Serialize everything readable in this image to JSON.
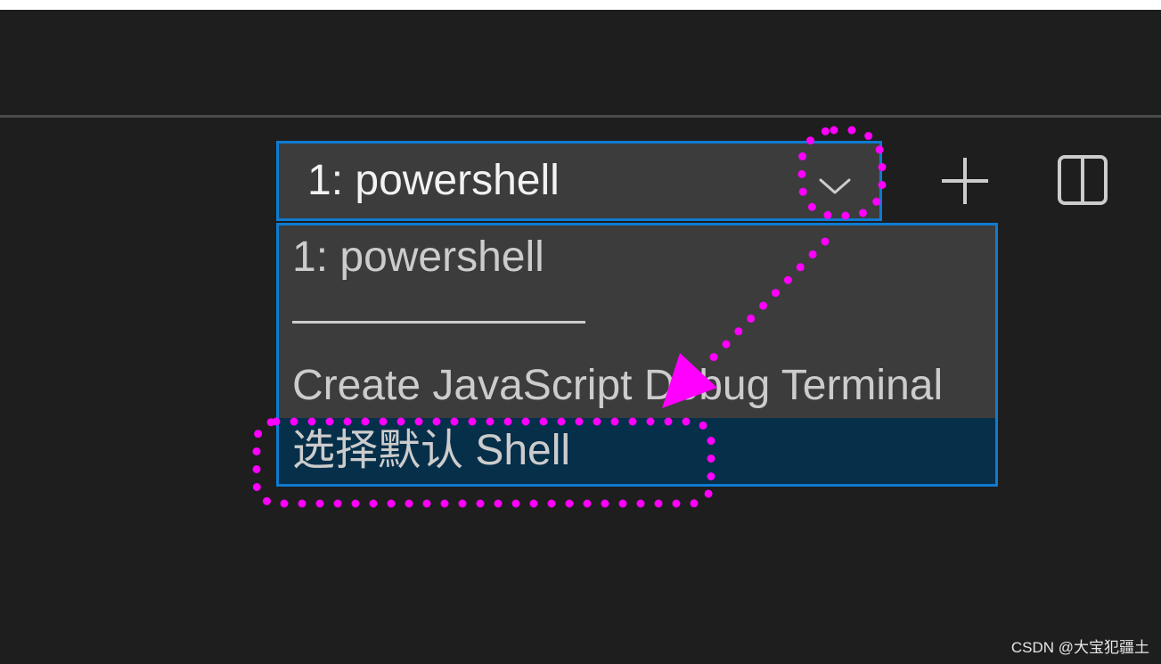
{
  "terminal": {
    "selector": {
      "value": "1: powershell",
      "icon": "chevron-down-icon",
      "expanded": true
    },
    "toolbar": {
      "new_terminal_icon": "plus-icon",
      "split_terminal_icon": "split-icon"
    },
    "dropdown": {
      "options": [
        {
          "label": "1: powershell",
          "selected": false
        },
        {
          "separator": true
        },
        {
          "label": "Create JavaScript Debug Terminal",
          "selected": false
        },
        {
          "label": "选择默认 Shell",
          "selected": true
        }
      ]
    }
  },
  "watermark": "CSDN @大宝犯疆土",
  "colors": {
    "background": "#1e1e1e",
    "control_background": "#3c3c3c",
    "focus_border": "#0e7bd1",
    "selected_background": "#062f4a",
    "foreground": "#cccccc",
    "annotation": "#ff00ff"
  }
}
